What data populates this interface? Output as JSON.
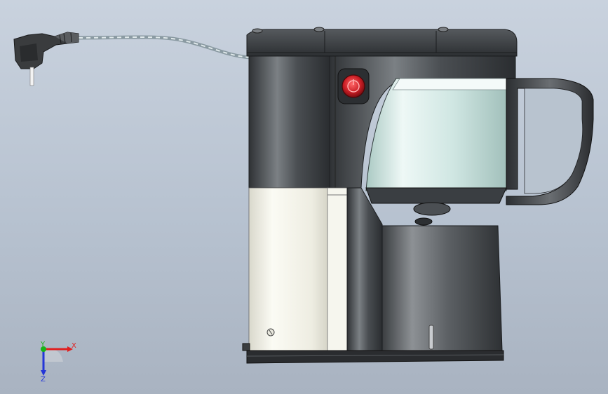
{
  "scene": {
    "model": "coffee-maker",
    "background_top": "#c9d2de",
    "background_bottom": "#a9b3c1",
    "body_color": "#3f4346",
    "reservoir_color": "#f2f1e6",
    "carafe_glass_color": "#d9eeea",
    "button_color": "#cc1f26"
  },
  "triad": {
    "x_label": "X",
    "y_label": "Y",
    "z_label": "Z",
    "x_color": "#e02020",
    "y_color": "#18b418",
    "z_color": "#2436d8"
  }
}
